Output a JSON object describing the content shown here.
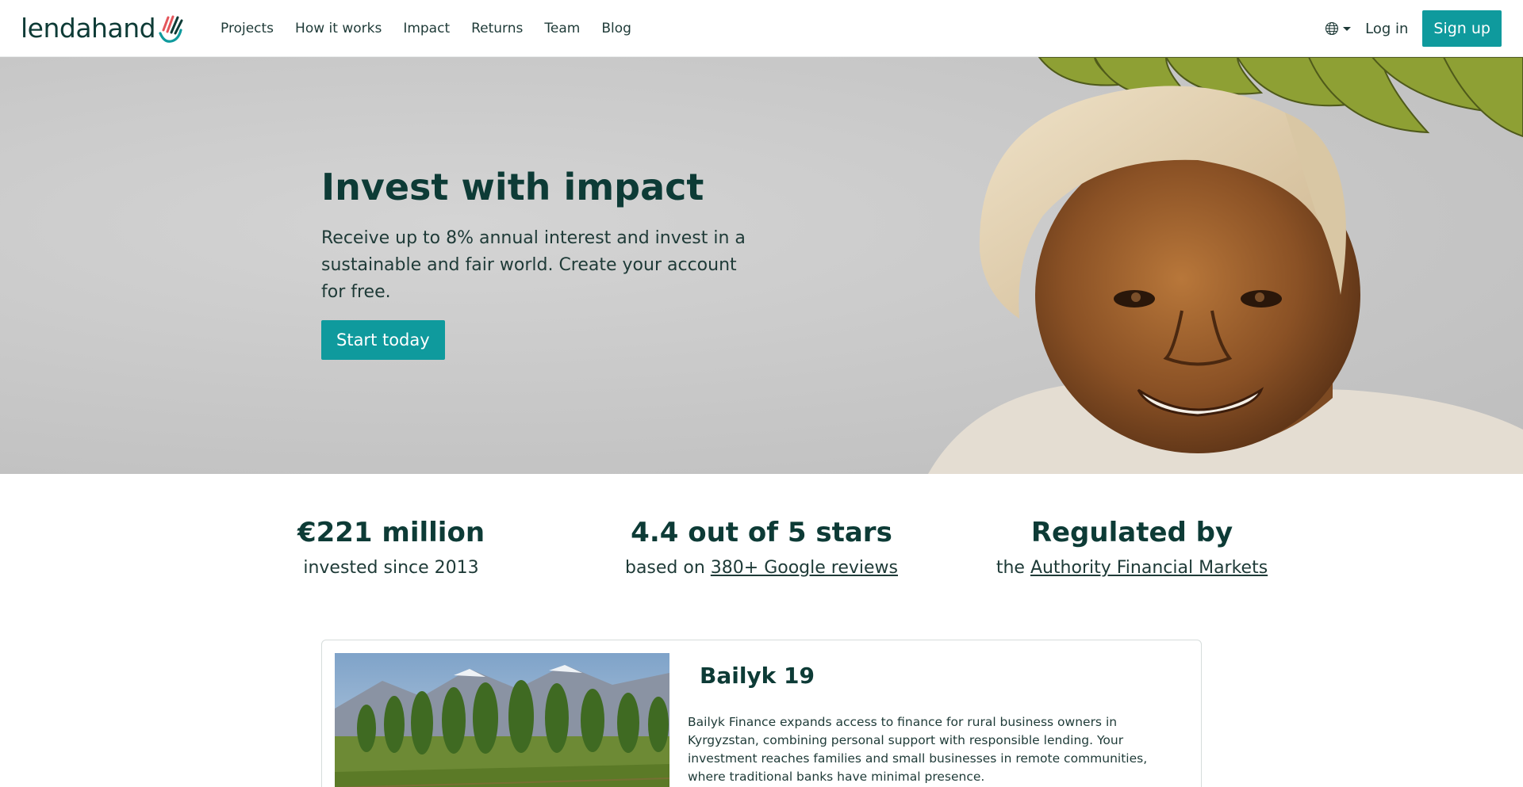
{
  "brand": {
    "name": "lendahand",
    "color": "#0f9a9d",
    "dark": "#0d3b36"
  },
  "nav": {
    "links": [
      "Projects",
      "How it works",
      "Impact",
      "Returns",
      "Team",
      "Blog"
    ],
    "language_icon": "globe-icon",
    "login": "Log in",
    "signup": "Sign up"
  },
  "hero": {
    "title": "Invest with impact",
    "subtitle": "Receive up to 8% annual interest and invest in a sustainable and fair world. Create your account for free.",
    "cta": "Start today"
  },
  "stats": [
    {
      "headline": "€221 million",
      "prefix": "invested since 2013",
      "link": ""
    },
    {
      "headline": "4.4 out of 5 stars",
      "prefix": "based on ",
      "link": "380+ Google reviews"
    },
    {
      "headline": "Regulated by",
      "prefix": "the ",
      "link": "Authority Financial Markets"
    }
  ],
  "project": {
    "title": "Bailyk 19",
    "description": "Bailyk Finance expands access to finance for rural business owners in Kyrgyzstan, combining personal support with responsible lending. Your investment reaches families and small businesses in remote communities, where traditional banks have minimal presence."
  }
}
